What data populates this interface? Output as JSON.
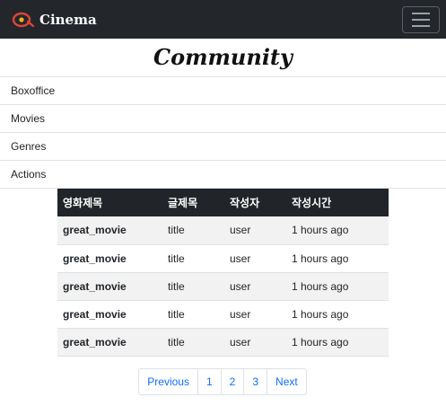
{
  "navbar": {
    "brand": "Cinema"
  },
  "page_title": "Community",
  "menu": [
    "Boxoffice",
    "Movies",
    "Genres",
    "Actions"
  ],
  "table": {
    "headers": [
      "영화제목",
      "글제목",
      "작성자",
      "작성시간"
    ],
    "rows": [
      [
        "great_movie",
        "title",
        "user",
        "1 hours ago"
      ],
      [
        "great_movie",
        "title",
        "user",
        "1 hours ago"
      ],
      [
        "great_movie",
        "title",
        "user",
        "1 hours ago"
      ],
      [
        "great_movie",
        "title",
        "user",
        "1 hours ago"
      ],
      [
        "great_movie",
        "title",
        "user",
        "1 hours ago"
      ]
    ]
  },
  "pagination": {
    "previous": "Previous",
    "pages": [
      "1",
      "2",
      "3"
    ],
    "next": "Next"
  },
  "colors": {
    "navbar_bg": "#23272b",
    "link": "#0d6efd",
    "logo_red": "#e0443a",
    "logo_yellow": "#f2b01e"
  },
  "icons": {
    "brand_logo": "film-reel-logo-icon",
    "toggler": "hamburger-menu-icon"
  }
}
